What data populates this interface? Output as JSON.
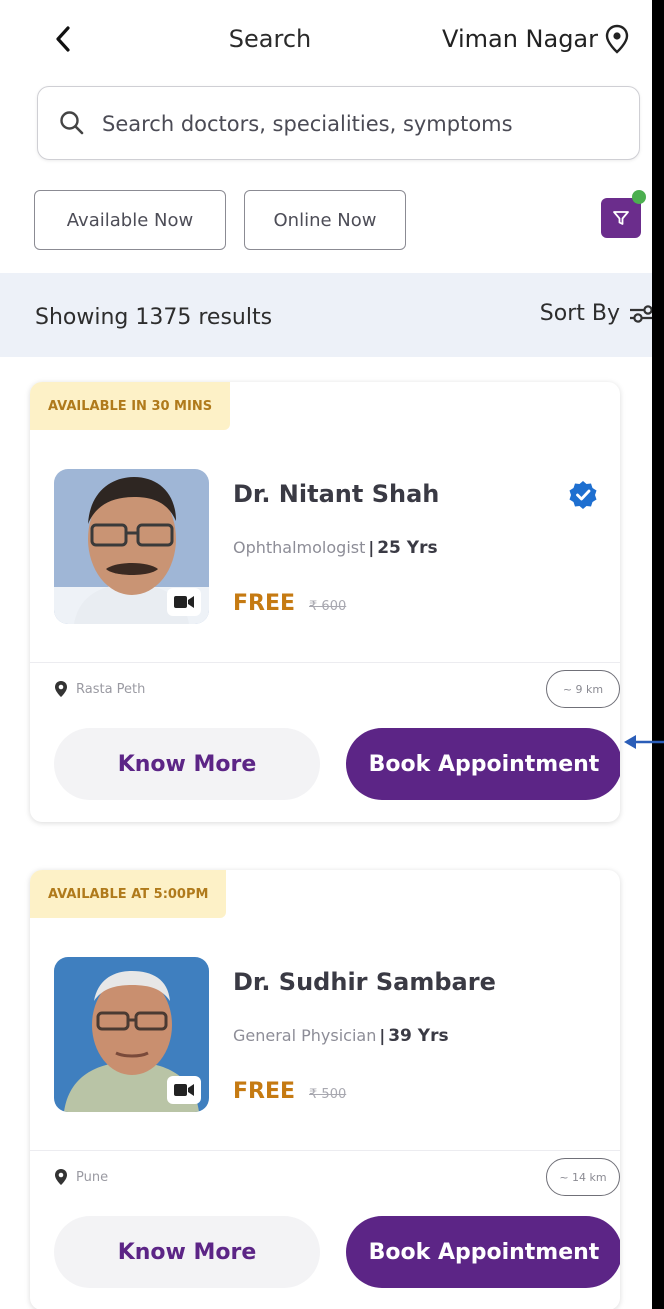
{
  "header": {
    "title": "Search",
    "location": "Viman Nagar",
    "icons": [
      "back-chevron-icon",
      "location-pin-icon"
    ]
  },
  "search": {
    "placeholder": "Search doctors, specialities, symptoms"
  },
  "filters": {
    "chips": [
      {
        "label": "Available Now"
      },
      {
        "label": "Online Now"
      }
    ],
    "filter_icon": "funnel-icon",
    "filter_active_dot_color": "#4caf50"
  },
  "results": {
    "count_text": "Showing 1375 results",
    "sort_label": "Sort By"
  },
  "theme": {
    "primary": "#5c2586",
    "badge_bg": "#fdf1c7",
    "badge_text": "#b07a1b",
    "price_color": "#c57a12",
    "verified": "#1e6fd0"
  },
  "doctors": [
    {
      "availability": "AVAILABLE IN 30 MINS",
      "name": "Dr. Nitant Shah",
      "speciality": "Ophthalmologist",
      "experience": "25 Yrs",
      "price": "FREE",
      "old_price": "₹ 600",
      "location": "Rasta Peth",
      "distance": "~ 9 km",
      "verified": true,
      "know_more": "Know More",
      "book": "Book Appointment"
    },
    {
      "availability": "AVAILABLE AT 5:00PM",
      "name": "Dr. Sudhir Sambare",
      "speciality": "General Physician",
      "experience": "39 Yrs",
      "price": "FREE",
      "old_price": "₹ 500",
      "location": "Pune",
      "distance": "~ 14 km",
      "verified": false,
      "know_more": "Know More",
      "book": "Book Appointment"
    }
  ]
}
